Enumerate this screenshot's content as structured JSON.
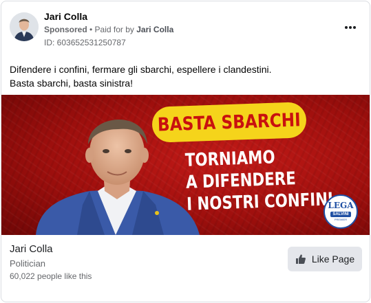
{
  "advertiser": {
    "name": "Jari Colla",
    "sponsored_label": "Sponsored",
    "separator": " • ",
    "paid_for_prefix": "Paid for by ",
    "paid_for_name": "Jari Colla",
    "ad_id": "ID: 603652531250787"
  },
  "post": {
    "line1": "Difendere i confini, fermare gli sbarchi, espellere i clandestini.",
    "line2": "Basta sbarchi, basta sinistra!"
  },
  "creative": {
    "pill_text": "BASTA SBARCHI",
    "headline_lines": [
      "TORNIAMO",
      "A DIFENDERE",
      "I NOSTRI CONFINI"
    ],
    "logo": {
      "top": "LEGA",
      "band": "SALVINI",
      "sub": "PREMIER"
    },
    "colors": {
      "background": "#b3130f",
      "pill": "#f5d41b",
      "pill_text": "#c8110f",
      "headline": "#ffffff",
      "logo_blue": "#1f4fa3"
    }
  },
  "page": {
    "name": "Jari Colla",
    "category": "Politician",
    "likes": "60,022 people like this",
    "like_button_label": "Like Page",
    "like_icon": "thumbs-up-icon"
  },
  "icons": {
    "more": "more-options-icon"
  }
}
